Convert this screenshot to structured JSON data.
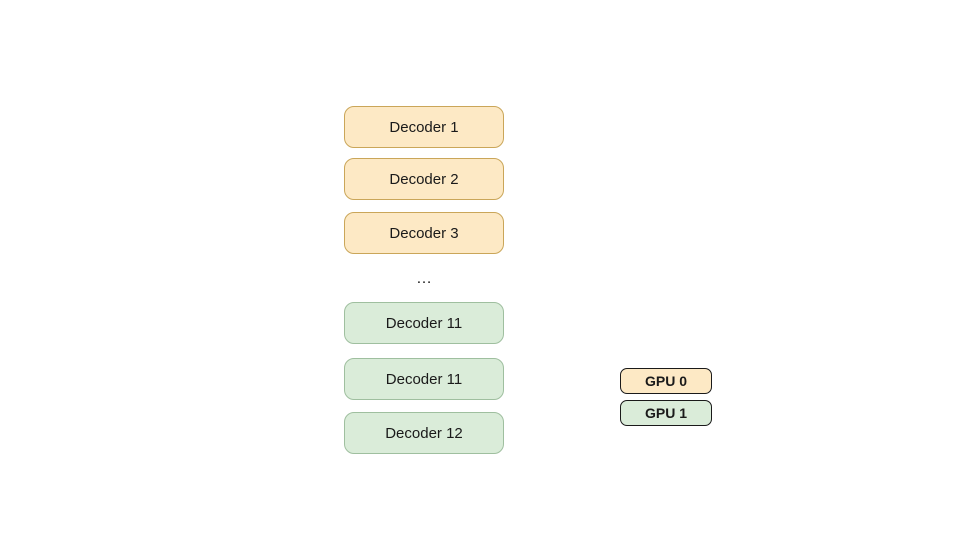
{
  "decoders": {
    "top": [
      {
        "label": "Decoder 1"
      },
      {
        "label": "Decoder 2"
      },
      {
        "label": "Decoder 3"
      }
    ],
    "ellipsis": "…",
    "bottom": [
      {
        "label": "Decoder 11"
      },
      {
        "label": "Decoder 11"
      },
      {
        "label": "Decoder 12"
      }
    ]
  },
  "legend": {
    "gpu0": "GPU 0",
    "gpu1": "GPU 1"
  },
  "colors": {
    "gpu0_bg": "#fde9c5",
    "gpu0_border": "#caa659",
    "gpu1_bg": "#daecd9",
    "gpu1_border": "#9fbf9f"
  }
}
